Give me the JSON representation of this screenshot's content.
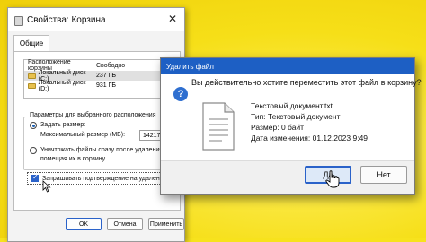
{
  "properties_window": {
    "title": "Свойства: Корзина",
    "close_label": "✕",
    "tab_general": "Общие",
    "locations_header": {
      "location": "Расположение корзины",
      "free": "Свободно"
    },
    "locations": [
      {
        "name": "Локальный диск (C:)",
        "free": "237 ГБ"
      },
      {
        "name": "Локальный диск (D:)",
        "free": "931 ГБ"
      }
    ],
    "params_legend": "Параметры для выбранного расположения",
    "option_custom_size": "Задать размер:",
    "max_size_label": "Максимальный размер (МБ):",
    "max_size_value": "14217",
    "option_delete_immediately_line1": "Уничтожать файлы сразу после удаления, не",
    "option_delete_immediately_line2": "помещая их в корзину",
    "confirm_delete_label": "Запрашивать подтверждение на удаление",
    "button_ok": "OK",
    "button_cancel": "Отмена",
    "button_apply": "Применить"
  },
  "delete_dialog": {
    "title": "Удалить файл",
    "question": "Вы действительно хотите переместить этот файл в корзину?",
    "file_name": "Текстовый документ.txt",
    "file_type": "Тип: Текстовый документ",
    "file_size": "Размер: 0 байт",
    "modified": "Дата изменения: 01.12.2023 9:49",
    "button_yes": "Да",
    "button_no": "Нет"
  },
  "colors": {
    "background": "#f7e21d",
    "accent": "#1d5fc4"
  },
  "icons": [
    "recycle-bin-icon",
    "drive-icon",
    "question-icon",
    "text-document-icon",
    "cursor-icon"
  ]
}
